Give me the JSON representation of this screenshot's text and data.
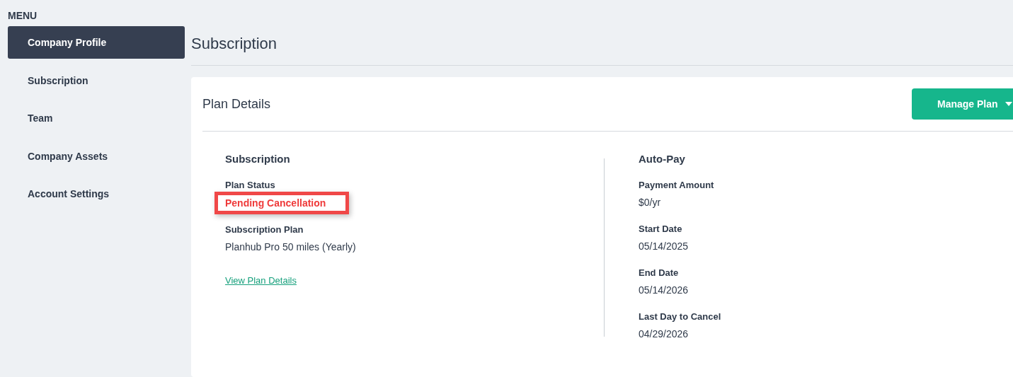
{
  "sidebar": {
    "heading": "MENU",
    "items": [
      {
        "label": "Company Profile",
        "selected": true
      },
      {
        "label": "Subscription",
        "selected": false
      },
      {
        "label": "Team",
        "selected": false
      },
      {
        "label": "Company Assets",
        "selected": false
      },
      {
        "label": "Account Settings",
        "selected": false
      }
    ]
  },
  "page_title": "Subscription",
  "card": {
    "title": "Plan Details",
    "action": {
      "label": "Manage Plan"
    },
    "columns": [
      {
        "title": "Subscription",
        "fields": [
          {
            "label": "Plan Status",
            "value": "Pending Cancellation",
            "kind": "status",
            "highlighted": true
          },
          {
            "label": "Subscription Plan",
            "value": "Planhub Pro 50 miles (Yearly)",
            "kind": "text",
            "highlighted": false
          }
        ],
        "link": "View Plan Details"
      },
      {
        "title": "Auto-Pay",
        "fields": [
          {
            "label": "Payment Amount",
            "value": "$0/yr",
            "kind": "text",
            "highlighted": false
          },
          {
            "label": "Start Date",
            "value": "05/14/2025",
            "kind": "text",
            "highlighted": false
          },
          {
            "label": "End Date",
            "value": "05/14/2026",
            "kind": "text",
            "highlighted": false
          },
          {
            "label": "Last Day to Cancel",
            "value": "04/29/2026",
            "kind": "text",
            "highlighted": false
          }
        ]
      }
    ]
  }
}
